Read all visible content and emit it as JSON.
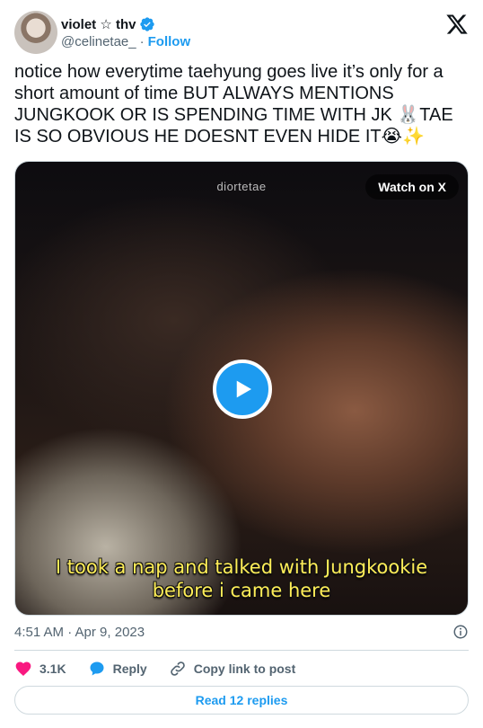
{
  "author": {
    "display_name": "violet ☆ thv",
    "handle": "@celinetae_",
    "separator": "·",
    "follow_label": "Follow",
    "verified_color": "#1d9bf0"
  },
  "tweet": {
    "text": "notice how everytime taehyung goes live it’s only for a short amount of time BUT ALWAYS MENTIONS JUNGKOOK OR IS SPENDING TIME WITH JK 🐰TAE IS SO OBVIOUS HE DOESNT EVEN HIDE IT😭✨"
  },
  "media": {
    "watermark": "diortetae",
    "watch_label": "Watch on X",
    "caption_line1": "I took a nap and talked with Jungkookie",
    "caption_line2": "before i came here",
    "play_icon": "play-icon"
  },
  "meta": {
    "timestamp": "4:51 AM · Apr 9, 2023",
    "info_icon": "info-icon"
  },
  "actions": {
    "like_count": "3.1K",
    "reply_label": "Reply",
    "copy_label": "Copy link to post",
    "like_color": "#f91880",
    "reply_color": "#1d9bf0"
  },
  "footer": {
    "read_replies_label": "Read 12 replies"
  }
}
